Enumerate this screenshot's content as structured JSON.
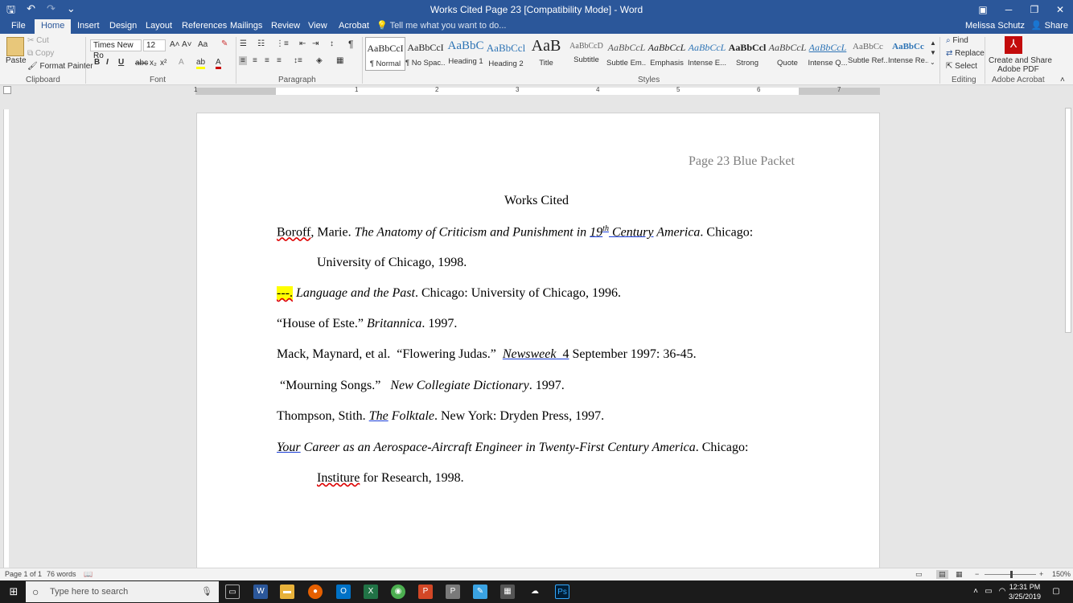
{
  "titlebar": {
    "title": "Works  Cited Page 23 [Compatibility Mode] - Word",
    "save_glyph": "🖫",
    "undo_glyph": "↶",
    "redo_glyph": "↷",
    "more_glyph": "⌄",
    "ribbon_display_glyph": "▣",
    "minimize_glyph": "─",
    "restore_glyph": "❐",
    "close_glyph": "✕"
  },
  "tabs": [
    "File",
    "Home",
    "Insert",
    "Design",
    "Layout",
    "References",
    "Mailings",
    "Review",
    "View",
    "Acrobat"
  ],
  "tell_me": "Tell me what you want to do...",
  "user": "Melissa Schutz",
  "share": "Share",
  "clipboard": {
    "paste": "Paste",
    "cut": "Cut",
    "copy": "Copy",
    "format_painter": "Format Painter",
    "label": "Clipboard"
  },
  "font": {
    "name": "Times New Ro",
    "size": "12",
    "label": "Font"
  },
  "paragraph": {
    "label": "Paragraph"
  },
  "styles": {
    "label": "Styles",
    "items": [
      {
        "preview": "AaBbCcI",
        "name": "¶ Normal"
      },
      {
        "preview": "AaBbCcI",
        "name": "¶ No Spac..."
      },
      {
        "preview": "AaBbC",
        "name": "Heading 1"
      },
      {
        "preview": "AaBbCcl",
        "name": "Heading 2"
      },
      {
        "preview": "AaB",
        "name": "Title"
      },
      {
        "preview": "AaBbCcD",
        "name": "Subtitle"
      },
      {
        "preview": "AaBbCcL",
        "name": "Subtle Em..."
      },
      {
        "preview": "AaBbCcL",
        "name": "Emphasis"
      },
      {
        "preview": "AaBbCcL",
        "name": "Intense E..."
      },
      {
        "preview": "AaBbCcl",
        "name": "Strong"
      },
      {
        "preview": "AaBbCcL",
        "name": "Quote"
      },
      {
        "preview": "AaBbCcL",
        "name": "Intense Q..."
      },
      {
        "preview": "AaBbCc",
        "name": "Subtle Ref..."
      },
      {
        "preview": "AaBbCc",
        "name": "Intense Re..."
      }
    ]
  },
  "editing": {
    "find": "Find",
    "replace": "Replace",
    "select": "Select",
    "label": "Editing"
  },
  "acrobat": {
    "create": "Create and Share",
    "pdf": "Adobe PDF",
    "label": "Adobe Acrobat"
  },
  "ruler": [
    "1",
    "1",
    "2",
    "3",
    "4",
    "5",
    "6",
    "7"
  ],
  "document": {
    "header": "Page 23 Blue Packet",
    "title": "Works Cited",
    "e1_author": "Boroff",
    "e1_a": ", Marie.  ",
    "e1_t1": "The Anatomy of Criticism and Punishment in ",
    "e1_t2": "19",
    "e1_sup": "th",
    "e1_t3": "  Century",
    "e1_t4": " America",
    "e1_end": ".  Chicago:",
    "e1_cont": "University of Chicago, 1998.",
    "e2_dash": "---.",
    "e2_t": "Language and the Past",
    "e2_rest": ". Chicago: University of Chicago, 1996.",
    "e3_a": "“House of Este.” ",
    "e3_t": "Britannica",
    "e3_rest": ".  1997.",
    "e4_a": "Mack, Maynard, et al.  “Flowering Judas.”  ",
    "e4_t": "Newsweek",
    "e4_u": "  4",
    "e4_rest": " September 1997: 36-45.",
    "e5_a": " “Mourning Songs.”   ",
    "e5_t": "New Collegiate Dictionary",
    "e5_rest": ". 1997.",
    "e6_a": "Thompson, Stith.  ",
    "e6_t1": "The",
    "e6_t2": " Folktale",
    "e6_rest": ".  New York: Dryden Press, 1997.",
    "e7_t1": "Your",
    "e7_t2": " Career as an Aerospace-Aircraft Engineer in Twenty-First Century America",
    "e7_rest": ".  Chicago:",
    "e7_c1": "Institure",
    "e7_c2": " for Research, 1998."
  },
  "status": {
    "page": "Page 1 of 1",
    "words": "76 words",
    "zoom": "150%"
  },
  "taskbar": {
    "search": "Type here to search",
    "time": "12:31 PM",
    "date": "3/25/2019"
  },
  "colors": {
    "word_blue": "#2b579a",
    "highlight": "#ffff00",
    "spell_red": "#d00000"
  }
}
